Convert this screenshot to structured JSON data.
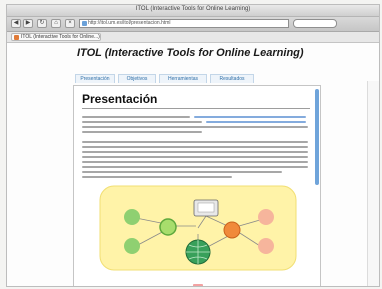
{
  "window": {
    "title": "ITOL (Interactive Tools for Online Learning)"
  },
  "toolbar": {
    "back_label": "◀",
    "forward_label": "▶",
    "url": "http://itol.um.es/itol/presentacion.html"
  },
  "bookmarks": {
    "tab_label": "ITOL (Interactive Tools for Online...)"
  },
  "site": {
    "title": "ITOL (Interactive Tools for Online Learning)",
    "nav": [
      "Presentación",
      "Objetivos",
      "Herramientas",
      "Resultados"
    ]
  },
  "page": {
    "heading": "Presentación"
  },
  "diagram": {
    "background": "#fff3a8",
    "node_color": "#78c25a",
    "accent_color": "#f08a3a",
    "secondary_color": "#f6b59c"
  }
}
